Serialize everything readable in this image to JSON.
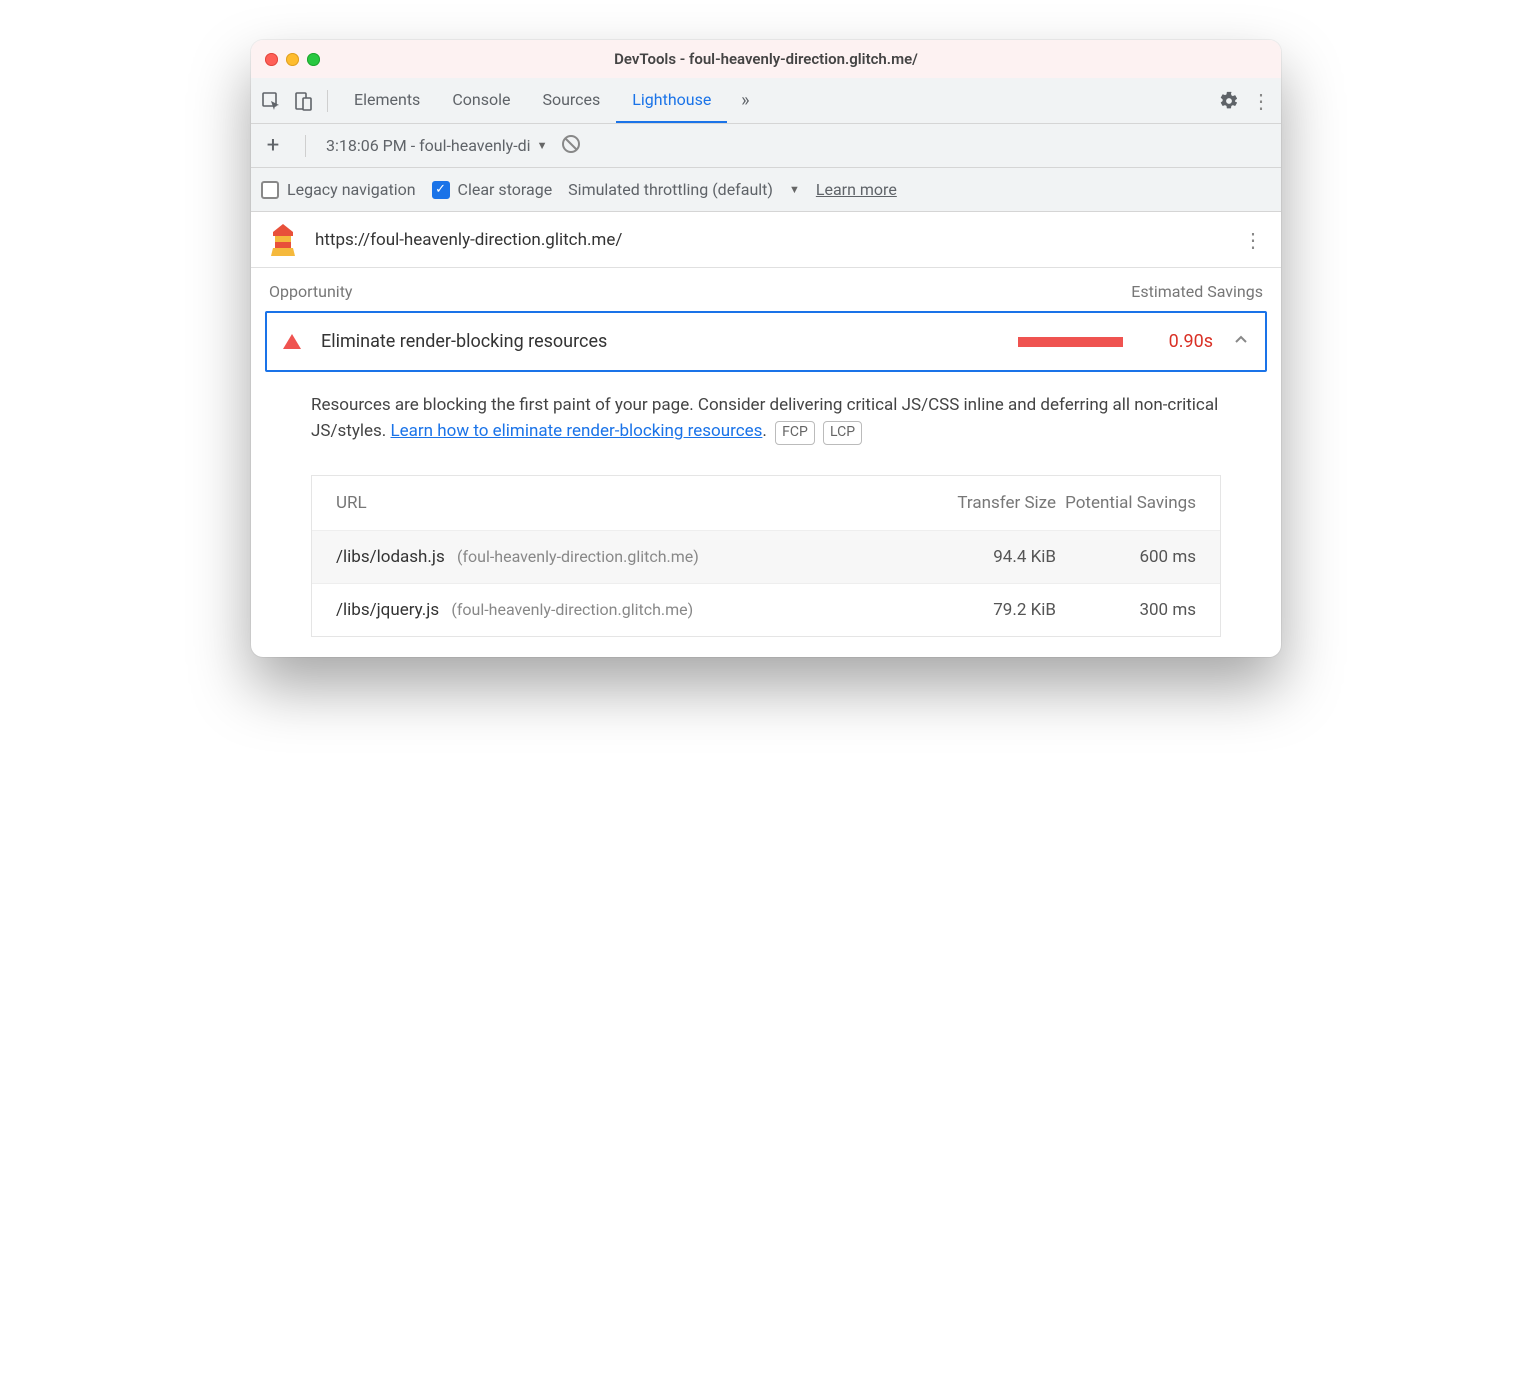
{
  "window": {
    "title": "DevTools - foul-heavenly-direction.glitch.me/"
  },
  "toolbar": {
    "tabs": [
      "Elements",
      "Console",
      "Sources",
      "Lighthouse"
    ],
    "active_tab": "Lighthouse"
  },
  "secondary": {
    "report_selector": "3:18:06 PM - foul-heavenly-di"
  },
  "options": {
    "legacy_nav_label": "Legacy navigation",
    "legacy_nav_checked": false,
    "clear_storage_label": "Clear storage",
    "clear_storage_checked": true,
    "throttling_label": "Simulated throttling (default)",
    "learn_more": "Learn more"
  },
  "report": {
    "url": "https://foul-heavenly-direction.glitch.me/",
    "section_left": "Opportunity",
    "section_right": "Estimated Savings"
  },
  "opportunity": {
    "title": "Eliminate render-blocking resources",
    "savings": "0.90s",
    "description_pre": "Resources are blocking the first paint of your page. Consider delivering critical JS/CSS inline and deferring all non-critical JS/styles. ",
    "description_link": "Learn how to eliminate render-blocking resources",
    "description_post": ".",
    "chips": [
      "FCP",
      "LCP"
    ]
  },
  "table": {
    "headers": {
      "url": "URL",
      "transfer": "Transfer Size",
      "savings": "Potential Savings"
    },
    "rows": [
      {
        "path": "/libs/lodash.js",
        "host": "(foul-heavenly-direction.glitch.me)",
        "transfer": "94.4 KiB",
        "savings": "600 ms"
      },
      {
        "path": "/libs/jquery.js",
        "host": "(foul-heavenly-direction.glitch.me)",
        "transfer": "79.2 KiB",
        "savings": "300 ms"
      }
    ]
  }
}
